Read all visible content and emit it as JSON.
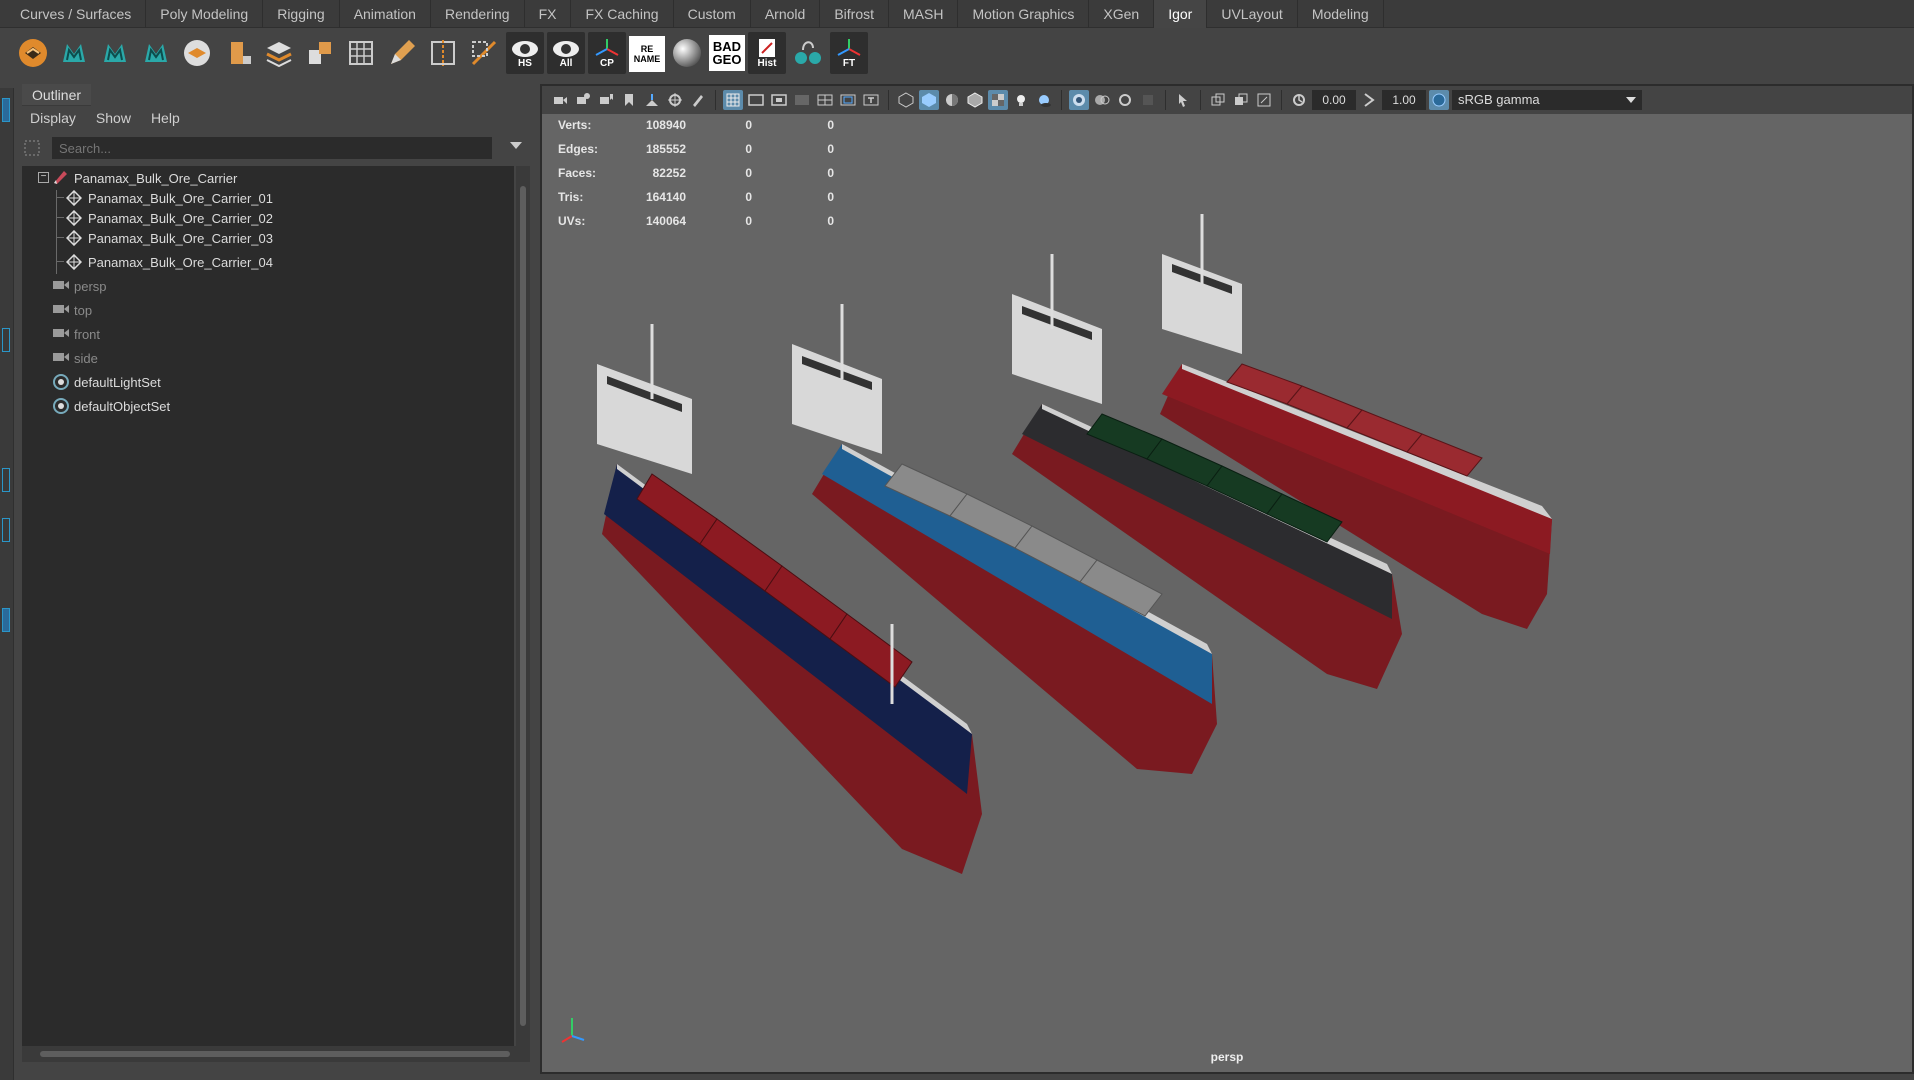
{
  "shelf": {
    "tabs": [
      {
        "label": "Curves / Surfaces"
      },
      {
        "label": "Poly Modeling"
      },
      {
        "label": "Rigging"
      },
      {
        "label": "Animation"
      },
      {
        "label": "Rendering"
      },
      {
        "label": "FX"
      },
      {
        "label": "FX Caching"
      },
      {
        "label": "Custom"
      },
      {
        "label": "Arnold"
      },
      {
        "label": "Bifrost"
      },
      {
        "label": "MASH"
      },
      {
        "label": "Motion Graphics"
      },
      {
        "label": "XGen"
      },
      {
        "label": "Igor"
      },
      {
        "label": "UVLayout"
      },
      {
        "label": "Modeling"
      }
    ],
    "active_tab": "Igor",
    "icon_labels": {
      "hs": "HS",
      "all": "All",
      "cp": "CP",
      "rename": "RE NAME",
      "badgeo": "BAD GEO",
      "hist": "Hist",
      "ft": "FT"
    }
  },
  "outliner": {
    "title": "Outliner",
    "menu": [
      "Display",
      "Show",
      "Help"
    ],
    "search_placeholder": "Search...",
    "tree": {
      "root": "Panamax_Bulk_Ore_Carrier",
      "children": [
        "Panamax_Bulk_Ore_Carrier_01",
        "Panamax_Bulk_Ore_Carrier_02",
        "Panamax_Bulk_Ore_Carrier_03",
        "Panamax_Bulk_Ore_Carrier_04"
      ],
      "cameras": [
        "persp",
        "top",
        "front",
        "side"
      ],
      "sets": [
        "defaultLightSet",
        "defaultObjectSet"
      ]
    }
  },
  "viewport": {
    "toolbar": {
      "exposure": "0.00",
      "gamma": "1.00",
      "color_space": "sRGB gamma"
    },
    "hud": [
      {
        "label": "Verts:",
        "v1": "108940",
        "v2": "0",
        "v3": "0"
      },
      {
        "label": "Edges:",
        "v1": "185552",
        "v2": "0",
        "v3": "0"
      },
      {
        "label": "Faces:",
        "v1": "82252",
        "v2": "0",
        "v3": "0"
      },
      {
        "label": "Tris:",
        "v1": "164140",
        "v2": "0",
        "v3": "0"
      },
      {
        "label": "UVs:",
        "v1": "140064",
        "v2": "0",
        "v3": "0"
      }
    ],
    "camera_label": "persp",
    "ship_colors": {
      "ship1_hull": "#14204a",
      "ship1_deck": "#8c1a22",
      "ship2_hull": "#1f5f93",
      "ship2_deck": "#8a8a8a",
      "ship3_hull": "#2c2c2f",
      "ship3_deck": "#163a22",
      "ship4_hull": "#8c1a22",
      "ship4_deck": "#9a2a30",
      "underwater": "#7a1a20",
      "superstructure": "#d8d8d8"
    }
  }
}
